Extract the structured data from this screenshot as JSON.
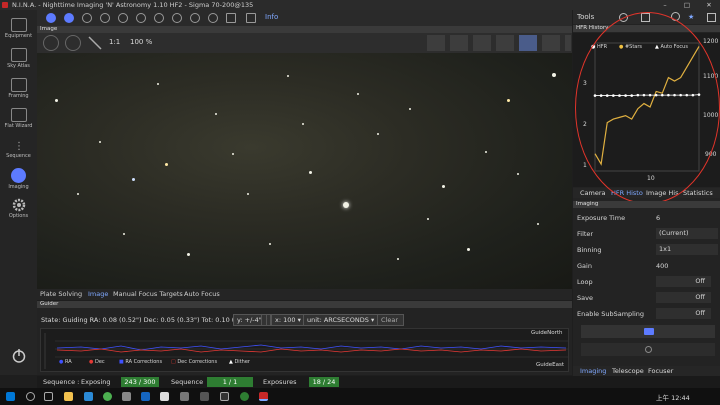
{
  "window": {
    "title": "N.I.N.A. - Nighttime Imaging 'N' Astronomy 1.10 HF2  -  Sigma 70-200@135"
  },
  "sidebar": {
    "items": [
      {
        "label": "Equipment"
      },
      {
        "label": "Sky Atlas"
      },
      {
        "label": "Framing"
      },
      {
        "label": "Flat Wizard"
      },
      {
        "label": "Sequence"
      },
      {
        "label": "Imaging"
      },
      {
        "label": "Options"
      }
    ]
  },
  "toolbar": {
    "info_label": "Info"
  },
  "image_panel": {
    "header": "Image",
    "zoom_1to1": "1:1",
    "zoom_percent": "100 %",
    "tabs": [
      "Plate Solving",
      "Image",
      "Manual Focus Targets",
      "Auto Focus"
    ],
    "active_tab": "Image"
  },
  "guider": {
    "header": "Guider",
    "state_text": "State: Guiding  RA: 0.08 (0.52\")  Dec: 0.05 (0.33\")  Tot: 0.10 (0.62\")",
    "y_select": "y: +/-4\"",
    "x_select": "x: 100",
    "unit_select": "unit: ARCSECONDS",
    "clear_label": "Clear",
    "label_north": "GuideNorth",
    "label_east": "GuideEast",
    "legend": [
      {
        "label": "RA",
        "color": "#3f51ff"
      },
      {
        "label": "Dec",
        "color": "#e53935"
      },
      {
        "label": "RA Corrections",
        "color": "#3f51ff"
      },
      {
        "label": "Dec Corrections",
        "color": "#e53935"
      },
      {
        "label": "Dither",
        "color": "#ffffff"
      }
    ]
  },
  "status": {
    "sequence_label": "Sequence :",
    "exposing_label": "Exposing",
    "exposing_value": "243 / 300",
    "seq_label": "Sequence",
    "seq_value": "1 / 1",
    "exposures_label": "Exposures",
    "exposures_value": "18 / 24"
  },
  "right": {
    "tools_label": "Tools",
    "hfr_header": "HFR History",
    "hfr_legend": [
      "HFR",
      "#Stars",
      "Auto Focus"
    ],
    "y_left_ticks": [
      "3",
      "2",
      "1"
    ],
    "y_right_ticks": [
      "1200",
      "1100",
      "1000",
      "900"
    ],
    "x_tick": "10",
    "tabs": [
      "Camera",
      "HFR Histo",
      "Image His",
      "Statistics"
    ],
    "active_tab": "HFR Histo"
  },
  "imaging": {
    "header": "Imaging",
    "rows": [
      {
        "label": "Exposure Time",
        "value": "6"
      },
      {
        "label": "Filter",
        "value": "(Current)"
      },
      {
        "label": "Binning",
        "value": "1x1"
      },
      {
        "label": "Gain",
        "value": "400"
      },
      {
        "label": "Loop",
        "value": "Off"
      },
      {
        "label": "Save",
        "value": "Off"
      },
      {
        "label": "Enable SubSampling",
        "value": "Off"
      }
    ],
    "bottom_tabs": [
      "Imaging",
      "Telescope",
      "Focuser"
    ]
  },
  "taskbar": {
    "time": "上午 12:44"
  },
  "chart_data": {
    "type": "line",
    "x": [
      1,
      2,
      3,
      4,
      5,
      6,
      7,
      8,
      9,
      10,
      11,
      12,
      13,
      14,
      15,
      16,
      17,
      18
    ],
    "series": [
      {
        "name": "HFR",
        "values": [
          2.45,
          2.45,
          2.45,
          2.45,
          2.45,
          2.45,
          2.45,
          2.46,
          2.46,
          2.46,
          2.46,
          2.46,
          2.46,
          2.46,
          2.46,
          2.46,
          2.46,
          2.47
        ]
      },
      {
        "name": "#Stars",
        "values": [
          900,
          870,
          990,
          1000,
          1005,
          1010,
          1000,
          1030,
          1045,
          1035,
          1080,
          1075,
          1120,
          1110,
          1120,
          1150,
          1180,
          1210
        ]
      }
    ],
    "y_left_range": [
      0.8,
      3.6
    ],
    "y_right_range": [
      850,
      1220
    ]
  }
}
